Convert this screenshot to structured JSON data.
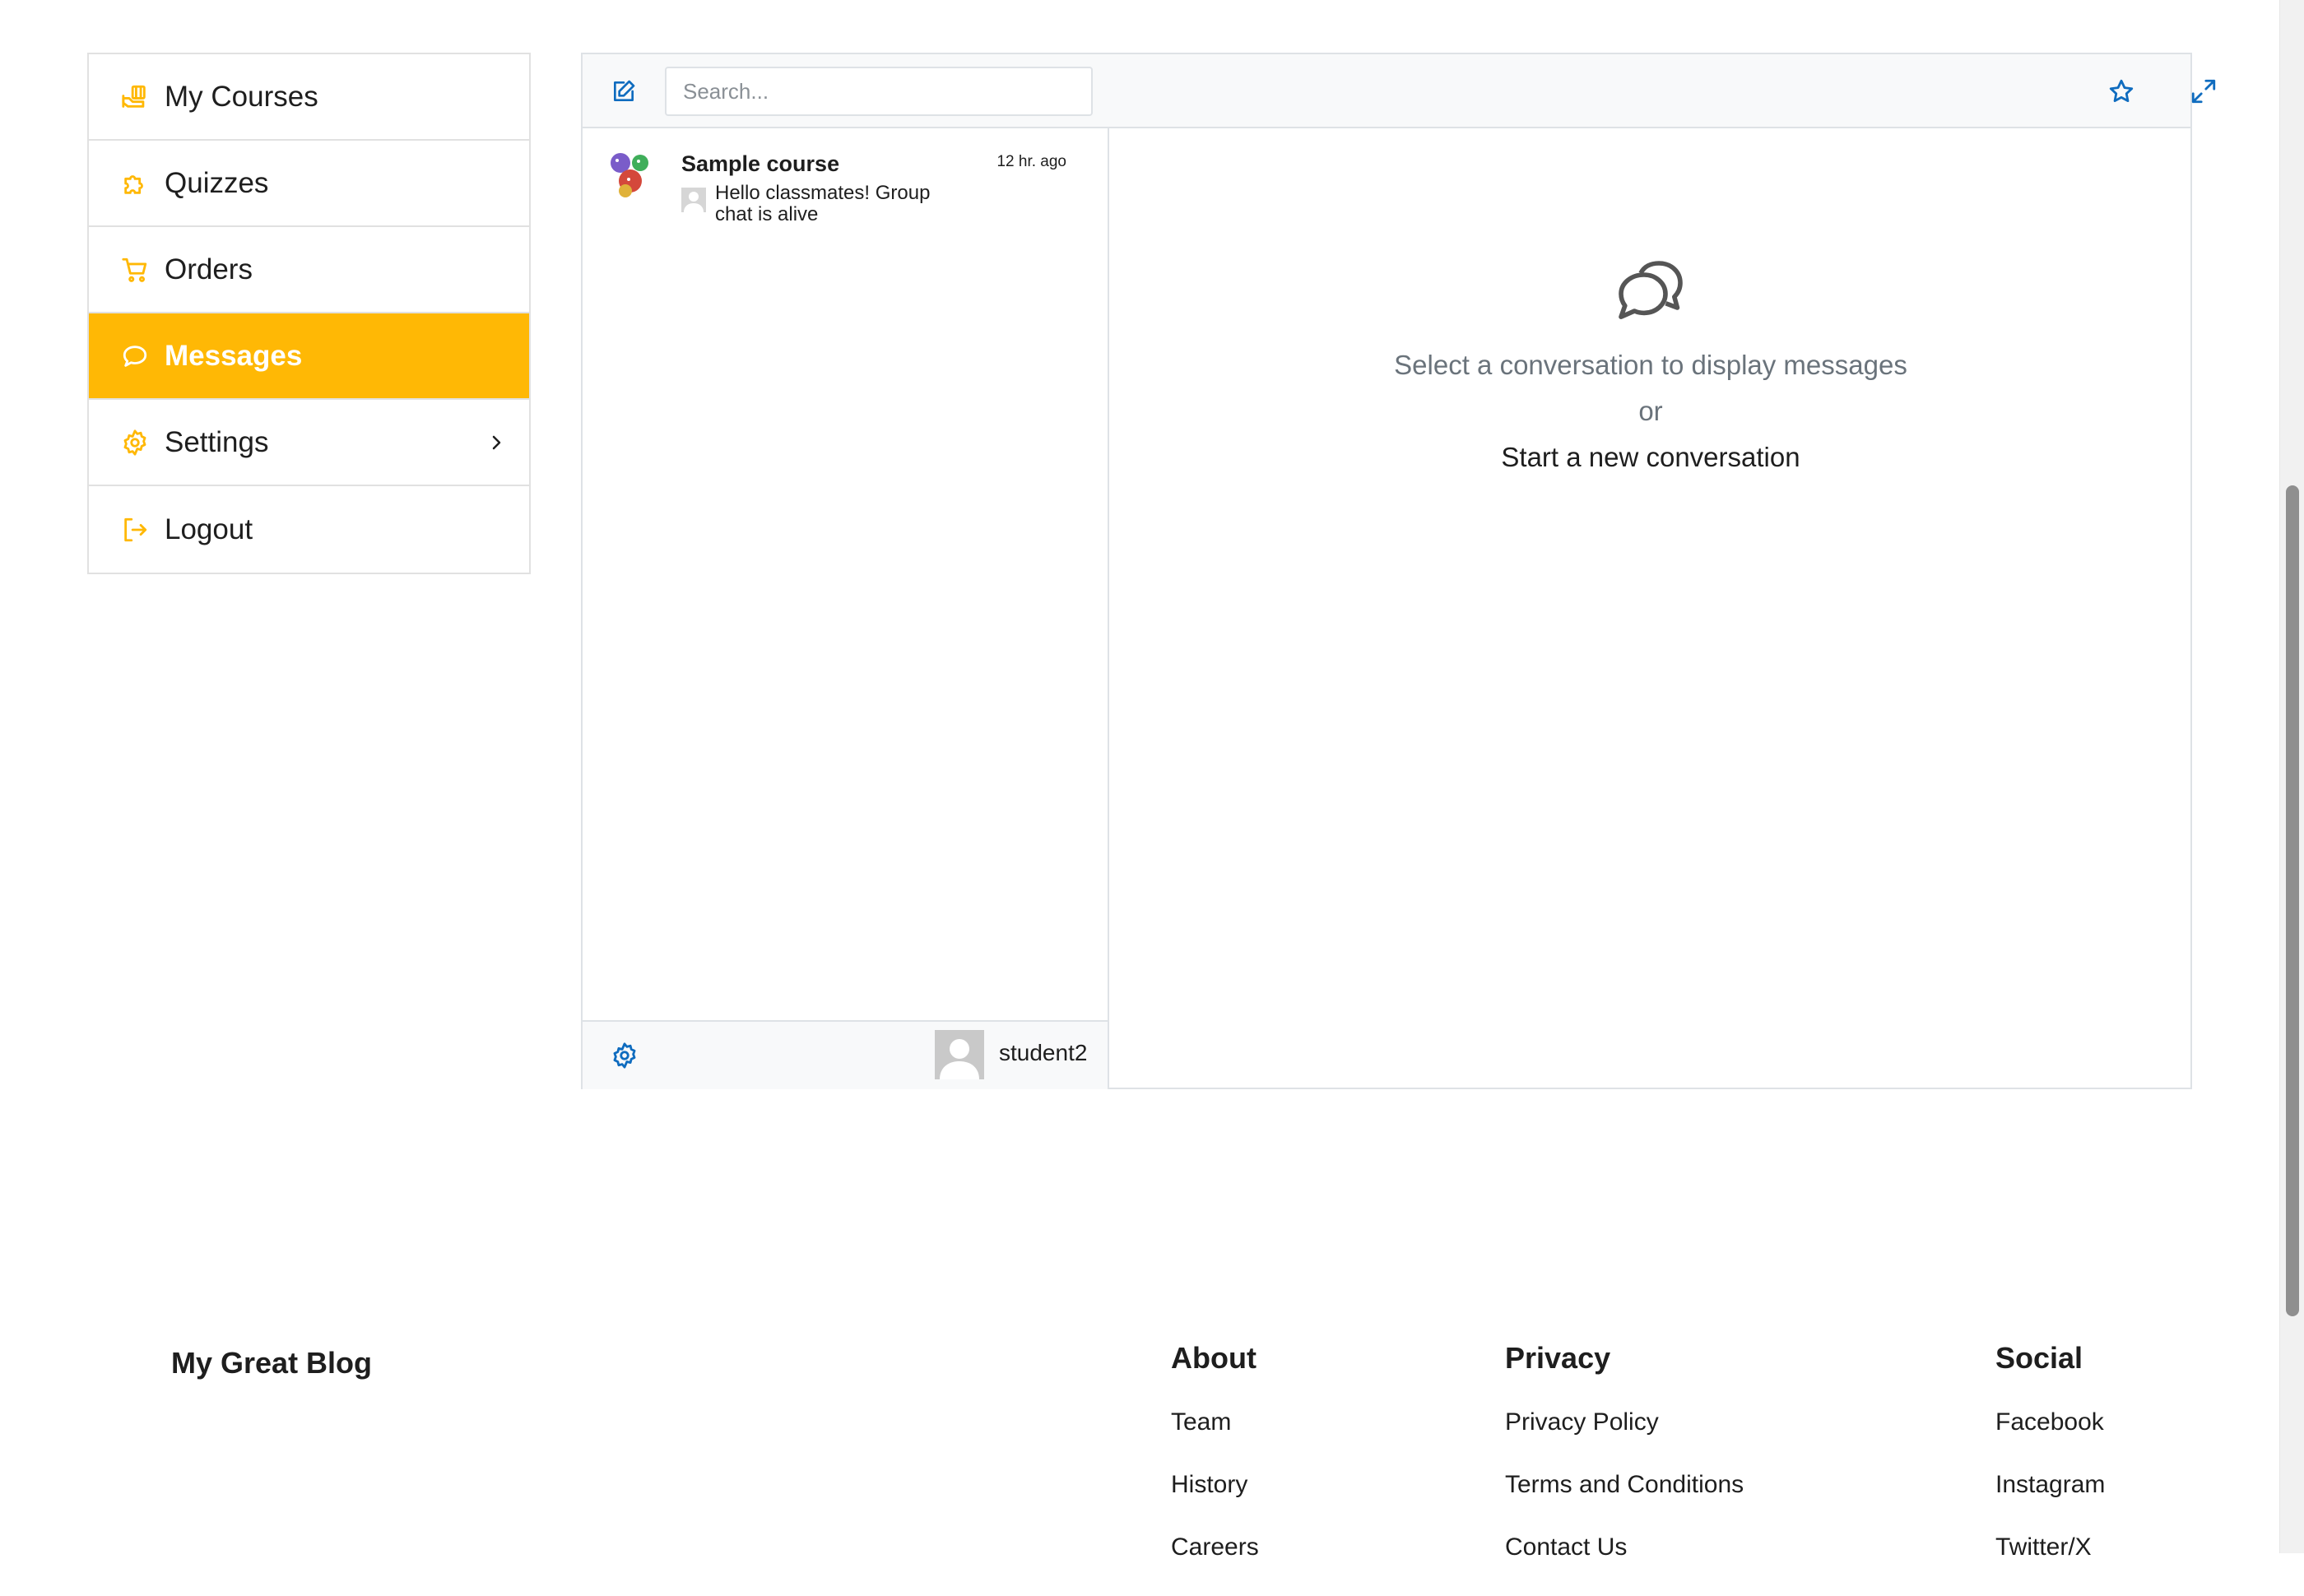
{
  "sidebar": {
    "items": [
      {
        "label": "My Courses",
        "icon": "courses-icon"
      },
      {
        "label": "Quizzes",
        "icon": "puzzle-icon"
      },
      {
        "label": "Orders",
        "icon": "cart-icon"
      },
      {
        "label": "Messages",
        "icon": "chat-icon",
        "active": true
      },
      {
        "label": "Settings",
        "icon": "gear-icon"
      },
      {
        "label": "Logout",
        "icon": "logout-icon"
      }
    ]
  },
  "messaging": {
    "search_placeholder": "Search...",
    "conversations": [
      {
        "title": "Sample course",
        "time": "12 hr. ago",
        "last_message": "Hello classmates! Group chat is alive"
      }
    ],
    "current_user": "student2",
    "empty_state": {
      "line1": "Select a conversation to display messages",
      "or": "or",
      "link": "Start a new conversation"
    }
  },
  "footer": {
    "site_title": "My Great Blog",
    "columns": [
      {
        "heading": "About",
        "links": [
          "Team",
          "History",
          "Careers"
        ]
      },
      {
        "heading": "Privacy",
        "links": [
          "Privacy Policy",
          "Terms and Conditions",
          "Contact Us"
        ]
      },
      {
        "heading": "Social",
        "links": [
          "Facebook",
          "Instagram",
          "Twitter/X"
        ]
      }
    ]
  },
  "colors": {
    "accent": "#ffb805",
    "icon_blue": "#0f6cbf",
    "text": "#1e1e1e",
    "muted": "#6a737b"
  }
}
